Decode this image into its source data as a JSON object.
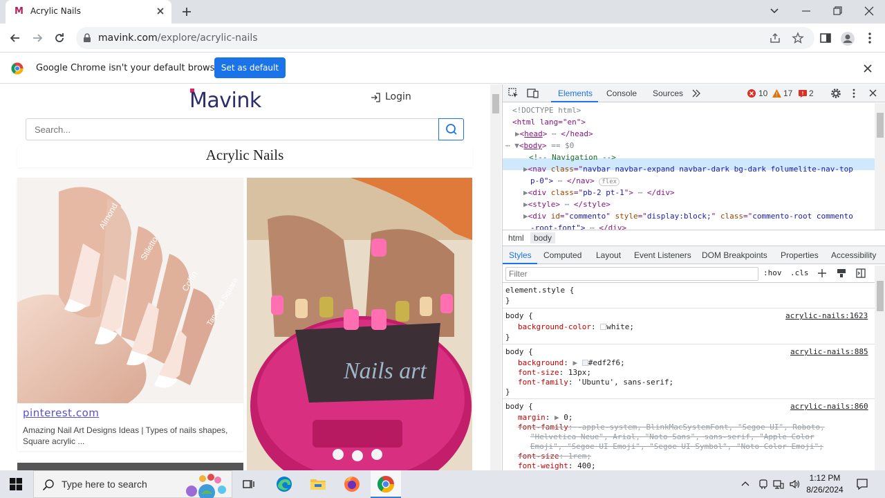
{
  "browser": {
    "tab_title": "Acrylic Nails",
    "favicon": "M",
    "url_domain": "mavink.com",
    "url_path": "/explore/acrylic-nails",
    "infobar_message": "Google Chrome isn't your default browser",
    "infobar_button": "Set as default"
  },
  "page": {
    "logo": "Mavink",
    "login_label": "Login",
    "search_placeholder": "Search...",
    "heading": "Acrylic Nails",
    "card1_source": "pinterest.com",
    "card1_description": "Amazing Nail Art Designs Ideas | Types of nails shapes, Square acrylic ...",
    "nail_labels": [
      "Almond",
      "Stiletto",
      "Coffin",
      "Tapered Square"
    ],
    "card2_overlay_text": "Nails art"
  },
  "devtools": {
    "tabs": [
      "Elements",
      "Console",
      "Sources"
    ],
    "error_count": "10",
    "warning_count": "17",
    "info_count": "2",
    "dom_lines": {
      "doctype": "<!DOCTYPE html>",
      "html_open": "<html lang=\"en\">",
      "head": "</head>",
      "body_eq": "== $0",
      "comment": "<!-- Navigation -->",
      "nav_class": "navbar navbar-expand navbar-dark bg-dark folumelite-nav-top",
      "nav_cont": "p-0\">",
      "flex_badge": "flex",
      "div_class": "pb-2 pt-1",
      "div_id": "commento",
      "div_style": "display:block;",
      "div_class2": "commento-root commento",
      "div_cont": "-root-font\">"
    },
    "breadcrumbs": [
      "html",
      "body"
    ],
    "subtabs": [
      "Styles",
      "Computed",
      "Layout",
      "Event Listeners",
      "DOM Breakpoints",
      "Properties",
      "Accessibility"
    ],
    "filter_placeholder": "Filter",
    "hov": ":hov",
    "cls": ".cls",
    "styles": {
      "element_style": "element.style {",
      "close": "}",
      "r1_selector": "body {",
      "r1_source": "acrylic-nails:1623",
      "r1_prop": "background-color",
      "r1_value": "white;",
      "r2_selector": "body {",
      "r2_source": "acrylic-nails:885",
      "r2_p1": "background",
      "r2_v1": "#edf2f6;",
      "r2_p2": "font-size",
      "r2_v2": "13px;",
      "r2_p3": "font-family",
      "r2_v3": "'Ubuntu', sans-serif;",
      "r3_selector": "body {",
      "r3_source": "acrylic-nails:860",
      "r3_p1": "margin",
      "r3_v1": "0;",
      "r3_p2": "font-family",
      "r3_v2a": "-apple-system, BlinkMacSystemFont, \"Segoe UI\", Roboto,",
      "r3_v2b": "\"Helvetica Neue\", Arial, \"Noto Sans\", sans-serif, \"Apple Color",
      "r3_v2c": "Emoji\", \"Segoe UI Emoji\", \"Segoe UI Symbol\", \"Noto Color Emoji\";",
      "r3_p3": "font-size",
      "r3_v3": "1rem;",
      "r3_p4": "font-weight",
      "r3_v4": "400;"
    }
  },
  "taskbar": {
    "search_placeholder": "Type here to search",
    "time": "1:12 PM",
    "date": "8/26/2024"
  }
}
